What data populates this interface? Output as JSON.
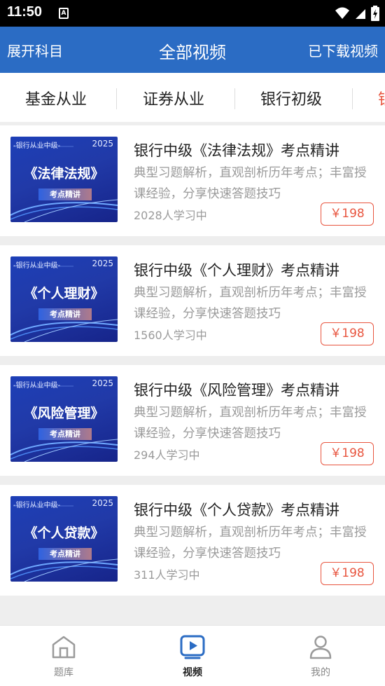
{
  "status_bar": {
    "time": "11:50",
    "notification_glyph": "A"
  },
  "app_bar": {
    "left_label": "展开科目",
    "title": "全部视频",
    "right_label": "已下载视频",
    "color": "#2b6cc4"
  },
  "tabs": [
    "基金从业",
    "证券从业",
    "银行初级",
    "银"
  ],
  "thumb_common": {
    "top_text": "-银行从业中级-",
    "year": "2025",
    "badge": "考点精讲"
  },
  "courses": [
    {
      "thumb_title": "《法律法规》",
      "title": "银行中级《法律法规》考点精讲",
      "desc": "典型习题解析，直观剖析历年考点；丰富授课经验，分享快速答题技巧",
      "count": "2028人学习中",
      "price": "￥198"
    },
    {
      "thumb_title": "《个人理财》",
      "title": "银行中级《个人理财》考点精讲",
      "desc": "典型习题解析，直观剖析历年考点；丰富授课经验，分享快速答题技巧",
      "count": "1560人学习中",
      "price": "￥198"
    },
    {
      "thumb_title": "《风险管理》",
      "title": "银行中级《风险管理》考点精讲",
      "desc": "典型习题解析，直观剖析历年考点；丰富授课经验，分享快速答题技巧",
      "count": "294人学习中",
      "price": "￥198"
    },
    {
      "thumb_title": "《个人贷款》",
      "title": "银行中级《个人贷款》考点精讲",
      "desc": "典型习题解析，直观剖析历年考点；丰富授课经验，分享快速答题技巧",
      "count": "311人学习中",
      "price": "￥198"
    }
  ],
  "bottom_nav": [
    {
      "label": "题库",
      "icon": "house-icon",
      "active": false
    },
    {
      "label": "视频",
      "icon": "video-play-icon",
      "active": true
    },
    {
      "label": "我的",
      "icon": "person-icon",
      "active": false
    }
  ],
  "accent_price_color": "#e8553f",
  "accent_nav_active_color": "#2b6cc4"
}
